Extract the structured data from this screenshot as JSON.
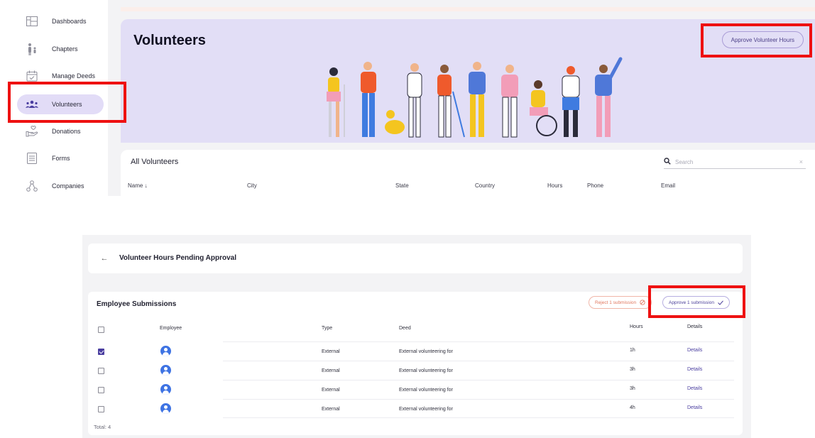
{
  "sidebar": {
    "items": [
      {
        "label": "Dashboards",
        "icon": "dashboard-icon"
      },
      {
        "label": "Chapters",
        "icon": "people-icon"
      },
      {
        "label": "Manage Deeds",
        "icon": "calendar-check-icon"
      },
      {
        "label": "Volunteers",
        "icon": "volunteers-icon",
        "active": true
      },
      {
        "label": "Donations",
        "icon": "hand-heart-icon"
      },
      {
        "label": "Forms",
        "icon": "form-icon"
      },
      {
        "label": "Companies",
        "icon": "companies-icon"
      }
    ]
  },
  "hero": {
    "title": "Volunteers",
    "approve_hours_label": "Approve Volunteer Hours"
  },
  "volunteers_list": {
    "title": "All Volunteers",
    "search_placeholder": "Search",
    "clear_symbol": "×",
    "columns": [
      "Name ↓",
      "City",
      "State",
      "Country",
      "Hours",
      "Phone",
      "Email"
    ]
  },
  "pending": {
    "back_symbol": "←",
    "title": "Volunteer Hours Pending Approval",
    "section_title": "Employee Submissions",
    "reject_label": "Reject 1 submission",
    "approve_label": "Approve 1 submission",
    "columns": {
      "employee": "Employee",
      "type": "Type",
      "deed": "Deed",
      "hours": "Hours",
      "details": "Details"
    },
    "rows": [
      {
        "checked": true,
        "type": "External",
        "deed": "External volunteering for",
        "hours": "1h",
        "details": "Details"
      },
      {
        "checked": false,
        "type": "External",
        "deed": "External volunteering for",
        "hours": "3h",
        "details": "Details"
      },
      {
        "checked": false,
        "type": "External",
        "deed": "External volunteering for",
        "hours": "3h",
        "details": "Details"
      },
      {
        "checked": false,
        "type": "External",
        "deed": "External volunteering for",
        "hours": "4h",
        "details": "Details"
      }
    ],
    "total": "Total: 4"
  },
  "colors": {
    "accent": "#4a3ea0",
    "hero_bg": "#e2def6",
    "highlight": "#ee1111",
    "avatar": "#3e73e3",
    "reject": "#e0775e"
  }
}
